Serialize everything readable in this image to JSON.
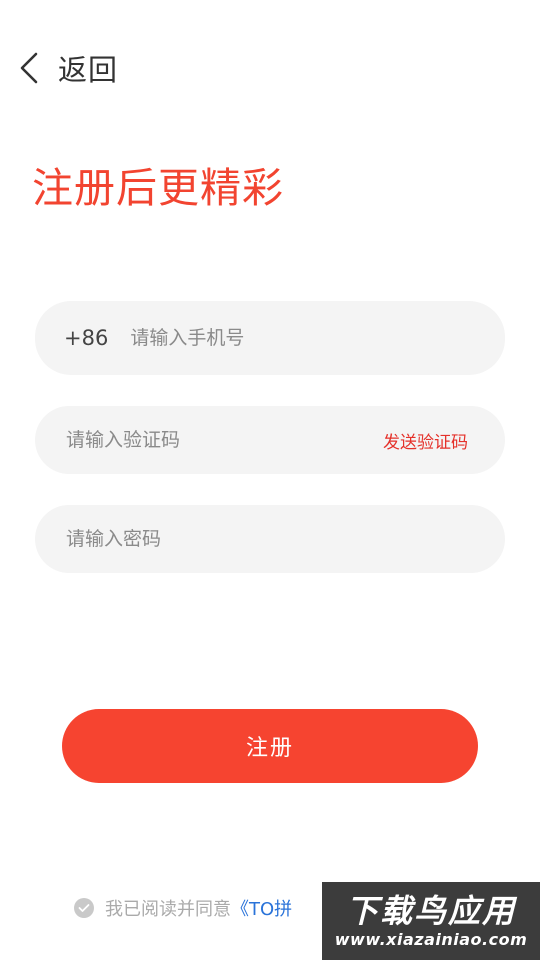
{
  "header": {
    "back_label": "返回"
  },
  "headline": "注册后更精彩",
  "form": {
    "phone": {
      "prefix": "+86",
      "placeholder": "请输入手机号"
    },
    "code": {
      "placeholder": "请输入验证码",
      "send_label": "发送验证码"
    },
    "password": {
      "placeholder": "请输入密码"
    },
    "submit_label": "注册"
  },
  "agreement": {
    "text": "我已阅读并同意",
    "link": "《TO拼"
  },
  "watermark": {
    "title": "下载鸟应用",
    "url": "www.xiazainiao.com"
  },
  "colors": {
    "accent": "#f64430",
    "headline": "#f24430",
    "link": "#2a73d9",
    "field_bg": "#f4f4f4"
  }
}
